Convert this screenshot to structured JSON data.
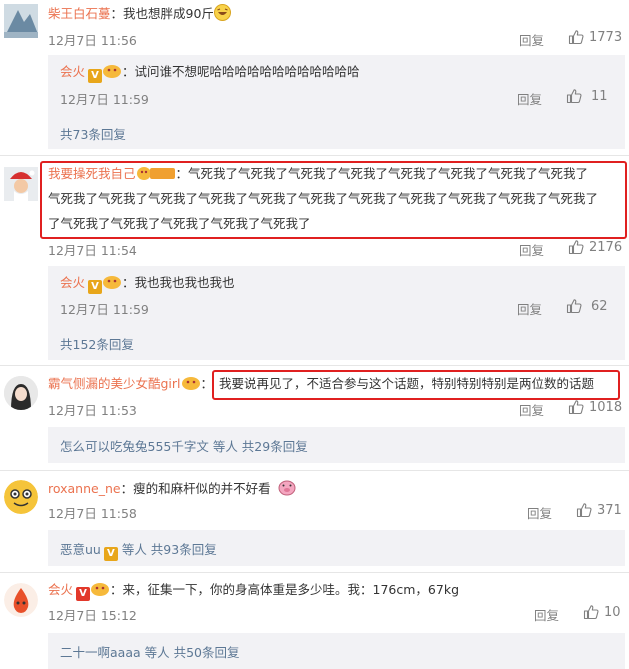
{
  "comments": [
    {
      "user": "柴王白石蔓",
      "text": "：我也想胖成90斤",
      "date": "12月7日 11:56",
      "reply_label": "回复",
      "likes": "1773",
      "subreply": {
        "user": "会火",
        "text": "：试问谁不想呢哈哈哈哈哈哈哈哈哈哈哈哈",
        "date": "12月7日 11:59",
        "reply_label": "回复",
        "likes": "11"
      },
      "more": "共73条回复"
    },
    {
      "user": "我要操死我自己",
      "badge": "铁粉",
      "text_line1": "：气死我了气死我了气死我了气死我了气死我了气死我了气死我了气死我了",
      "text_line2": "气死我了气死我了气死我了气死我了气死我了气死我了气死我了气死我了气死我了气死我了气死我了",
      "text_line3": "了气死我了气死我了气死我了气死我了气死我了",
      "date": "12月7日 11:54",
      "reply_label": "回复",
      "likes": "2176",
      "subreply": {
        "user": "会火",
        "text": "：我也我也我也我也",
        "date": "12月7日 11:59",
        "reply_label": "回复",
        "likes": "62"
      },
      "more": "共152条回复"
    },
    {
      "user": "霸气侧漏的美少女酷girl",
      "text": "我要说再见了，不适合参与这个话题，特别特别特别是两位数的话题",
      "date": "12月7日 11:53",
      "reply_label": "回复",
      "likes": "1018",
      "more_user": "怎么可以吃兔兔555千字文",
      "more_rest": " 等人 共29条回复"
    },
    {
      "user": "roxanne_ne",
      "text": "：瘦的和麻杆似的并不好看",
      "date": "12月7日 11:58",
      "reply_label": "回复",
      "likes": "371",
      "more_user": "恶意uu",
      "more_rest": " 等人 共93条回复"
    },
    {
      "user": "会火",
      "text": "：来，征集一下，你的身高体重是多少哇。我：176cm，67kg",
      "date": "12月7日 15:12",
      "reply_label": "回复",
      "likes": "10",
      "more_user": "二十一啊aaaa",
      "more_rest": " 等人 共50条回复"
    }
  ],
  "colors": {
    "username": "#eb7350",
    "link": "#5d7895",
    "highlight_box": "#e02020"
  },
  "icons": [
    "thumbs-up-icon",
    "verified-badge-icon",
    "fan-badge-icon",
    "emoji-icon"
  ]
}
